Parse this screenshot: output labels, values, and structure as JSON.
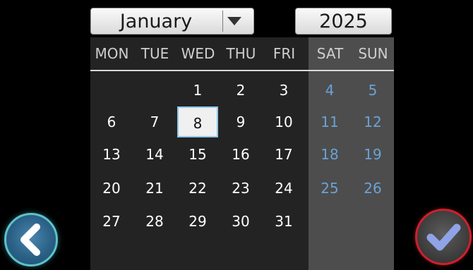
{
  "date_picker": {
    "month_select": {
      "selected": "January"
    },
    "year_field": {
      "value": "2025"
    },
    "weekdays": [
      "MON",
      "TUE",
      "WED",
      "THU",
      "FRI",
      "SAT",
      "SUN"
    ],
    "weeks": [
      [
        "",
        "",
        "1",
        "2",
        "3",
        "4",
        "5"
      ],
      [
        "6",
        "7",
        "8",
        "9",
        "10",
        "11",
        "12"
      ],
      [
        "13",
        "14",
        "15",
        "16",
        "17",
        "18",
        "19"
      ],
      [
        "20",
        "21",
        "22",
        "23",
        "24",
        "25",
        "26"
      ],
      [
        "27",
        "28",
        "29",
        "30",
        "31",
        "",
        ""
      ]
    ],
    "selected_day": "8"
  },
  "buttons": {
    "back_icon": "chevron-left-icon",
    "confirm_icon": "checkmark-icon"
  },
  "colors": {
    "weekend_text": "#6aa2d6",
    "back_ring": "#5cc3c9",
    "confirm_ring": "#d0202c",
    "checkmark": "#8fa3e6"
  }
}
